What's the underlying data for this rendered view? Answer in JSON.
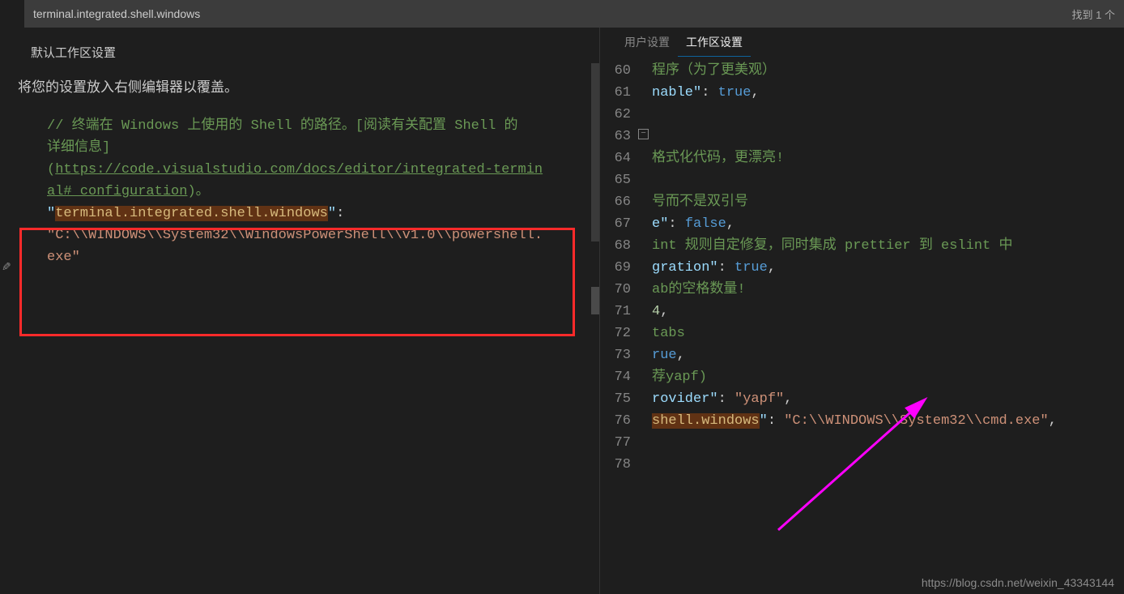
{
  "search": {
    "value": "terminal.integrated.shell.windows",
    "result_text": "找到 1 个"
  },
  "left": {
    "header": "默认工作区设置",
    "subtitle": "将您的设置放入右侧编辑器以覆盖。",
    "comment_line1_a": "// 终端在 ",
    "comment_line1_b": "Windows",
    "comment_line1_c": " 上使用的 ",
    "comment_line1_d": "Shell",
    "comment_line1_e": " 的路径。[阅读有关配置 ",
    "comment_line1_f": "Shell",
    "comment_line1_g": " 的",
    "comment_line2": "详细信息]",
    "url_open": "(",
    "url": "https://code.visualstudio.com/docs/editor/integrated-termin",
    "url_cont": "al#_configuration",
    "url_close": ")。",
    "key_quote_open": "\"",
    "key_highlight": "terminal.integrated.shell.windows",
    "key_quote_close": "\"",
    "colon": ":",
    "val1": "\"C:\\\\WINDOWS\\\\System32\\\\WindowsPowerShell\\\\v1.0\\\\powershell.",
    "val2": "exe\""
  },
  "right": {
    "tabs": {
      "user": "用户设置",
      "workspace": "工作区设置"
    },
    "lines": [
      {
        "n": "60",
        "frag_comment": "程序（为了更美观）"
      },
      {
        "n": "61",
        "frag_key": "nable\"",
        "p1": ": ",
        "frag_bool": "true",
        "p2": ","
      },
      {
        "n": "62",
        "empty": true
      },
      {
        "n": "63",
        "fold": true,
        "empty": true
      },
      {
        "n": "64",
        "frag_comment": "格式化代码，更漂亮!"
      },
      {
        "n": "65",
        "empty": true
      },
      {
        "n": "66",
        "frag_comment": "号而不是双引号"
      },
      {
        "n": "67",
        "frag_key": "e\"",
        "p1": ": ",
        "frag_bool": "false",
        "p2": ","
      },
      {
        "n": "68",
        "frag_comment_a": "int 规则自定修复，同时集成 ",
        "frag_comment_b": "prettier",
        "frag_comment_c": " 到 ",
        "frag_comment_d": "eslint",
        "frag_comment_e": " 中"
      },
      {
        "n": "69",
        "frag_key": "gration\"",
        "p1": ": ",
        "frag_bool": "true",
        "p2": ","
      },
      {
        "n": "70",
        "frag_comment": "ab的空格数量!"
      },
      {
        "n": "71",
        "frag_num": "4",
        "p2": ","
      },
      {
        "n": "72",
        "frag_comment": "tabs"
      },
      {
        "n": "73",
        "frag_bool_partial": "rue",
        "p2": ","
      },
      {
        "n": "74",
        "frag_comment": "荐yapf)"
      },
      {
        "n": "75",
        "frag_key": "rovider\"",
        "p1": ": ",
        "frag_str": "\"yapf\"",
        "p2": ","
      },
      {
        "n": "76",
        "frag_key_hl": "shell.windows",
        "frag_key_tail": "\"",
        "p1": ": ",
        "frag_str": "\"C:\\\\WINDOWS\\\\System32\\\\cmd.exe\"",
        "p2": ","
      },
      {
        "n": "77",
        "empty": true
      },
      {
        "n": "78",
        "empty": true
      }
    ],
    "watermark": "https://blog.csdn.net/weixin_43343144"
  }
}
